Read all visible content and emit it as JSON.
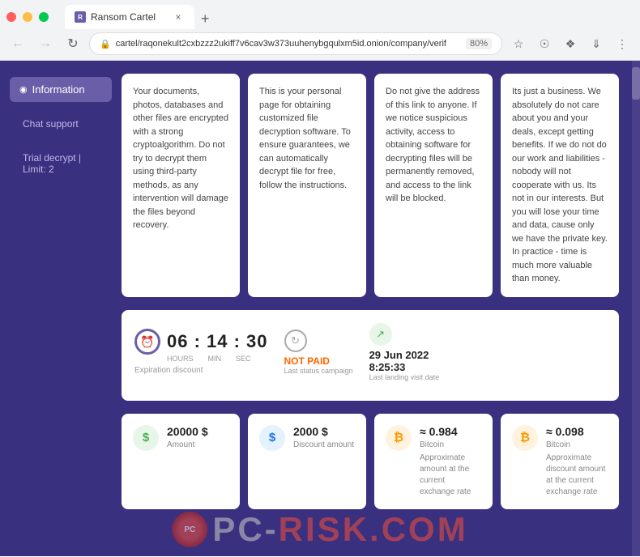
{
  "browser": {
    "tab_title": "Ransom Cartel",
    "url": "cartel/raqonekult2cxbzzz2ukiff7v6cav3w373uuhenybgqulxm5id.onion/company/verif",
    "zoom": "80%"
  },
  "sidebar": {
    "items": [
      {
        "label": "Information",
        "active": true
      },
      {
        "label": "Chat support",
        "active": false
      },
      {
        "label": "Trial decrypt | Limit: 2",
        "active": false
      }
    ]
  },
  "cards": [
    {
      "text": "Your documents, photos, databases and other files are encrypted with a strong cryptoalgorithm. Do not try to decrypt them using third-party methods, as any intervention will damage the files beyond recovery."
    },
    {
      "text": "This is your personal page for obtaining customized file decryption software. To ensure guarantees, we can automatically decrypt file for free, follow the instructions."
    },
    {
      "text": "Do not give the address of this link to anyone. If we notice suspicious activity, access to obtaining software for decrypting files will be permanently removed, and access to the link will be blocked."
    },
    {
      "text": "Its just a business. We absolutely do not care about you and your deals, except getting benefits. If we do not do our work and liabilities - nobody will not cooperate with us. Its not in our interests. But you will lose your time and data, cause only we have the private key. In practice - time is much more valuable than money."
    }
  ],
  "status": {
    "timer": "06 : 14 : 30",
    "timer_labels": [
      "HOURS",
      "MIN",
      "SEC"
    ],
    "expiration_label": "Expiration discount",
    "payment_status": "NOT PAID",
    "last_status_label": "Last status campaign",
    "date_value": "29 Jun 2022\n8:25:33",
    "date_label": "Last landing visit date"
  },
  "amounts": [
    {
      "icon": "$",
      "icon_type": "green",
      "value": "20000 $",
      "label": "Amount"
    },
    {
      "icon": "$",
      "icon_type": "blue",
      "value": "2000 $",
      "label": "Discount amount"
    },
    {
      "icon": "₿",
      "icon_type": "orange",
      "value": "≈ 0.984",
      "sublabel": "Bitcoin",
      "label": "Approximate amount at the current exchange rate"
    },
    {
      "icon": "₿",
      "icon_type": "orange",
      "value": "≈ 0.098",
      "sublabel": "Bitcoin",
      "label": "Approximate discount amount at the current exchange rate"
    }
  ],
  "watermark": {
    "text_before": "PC",
    "text_after": "RISK.COM"
  }
}
